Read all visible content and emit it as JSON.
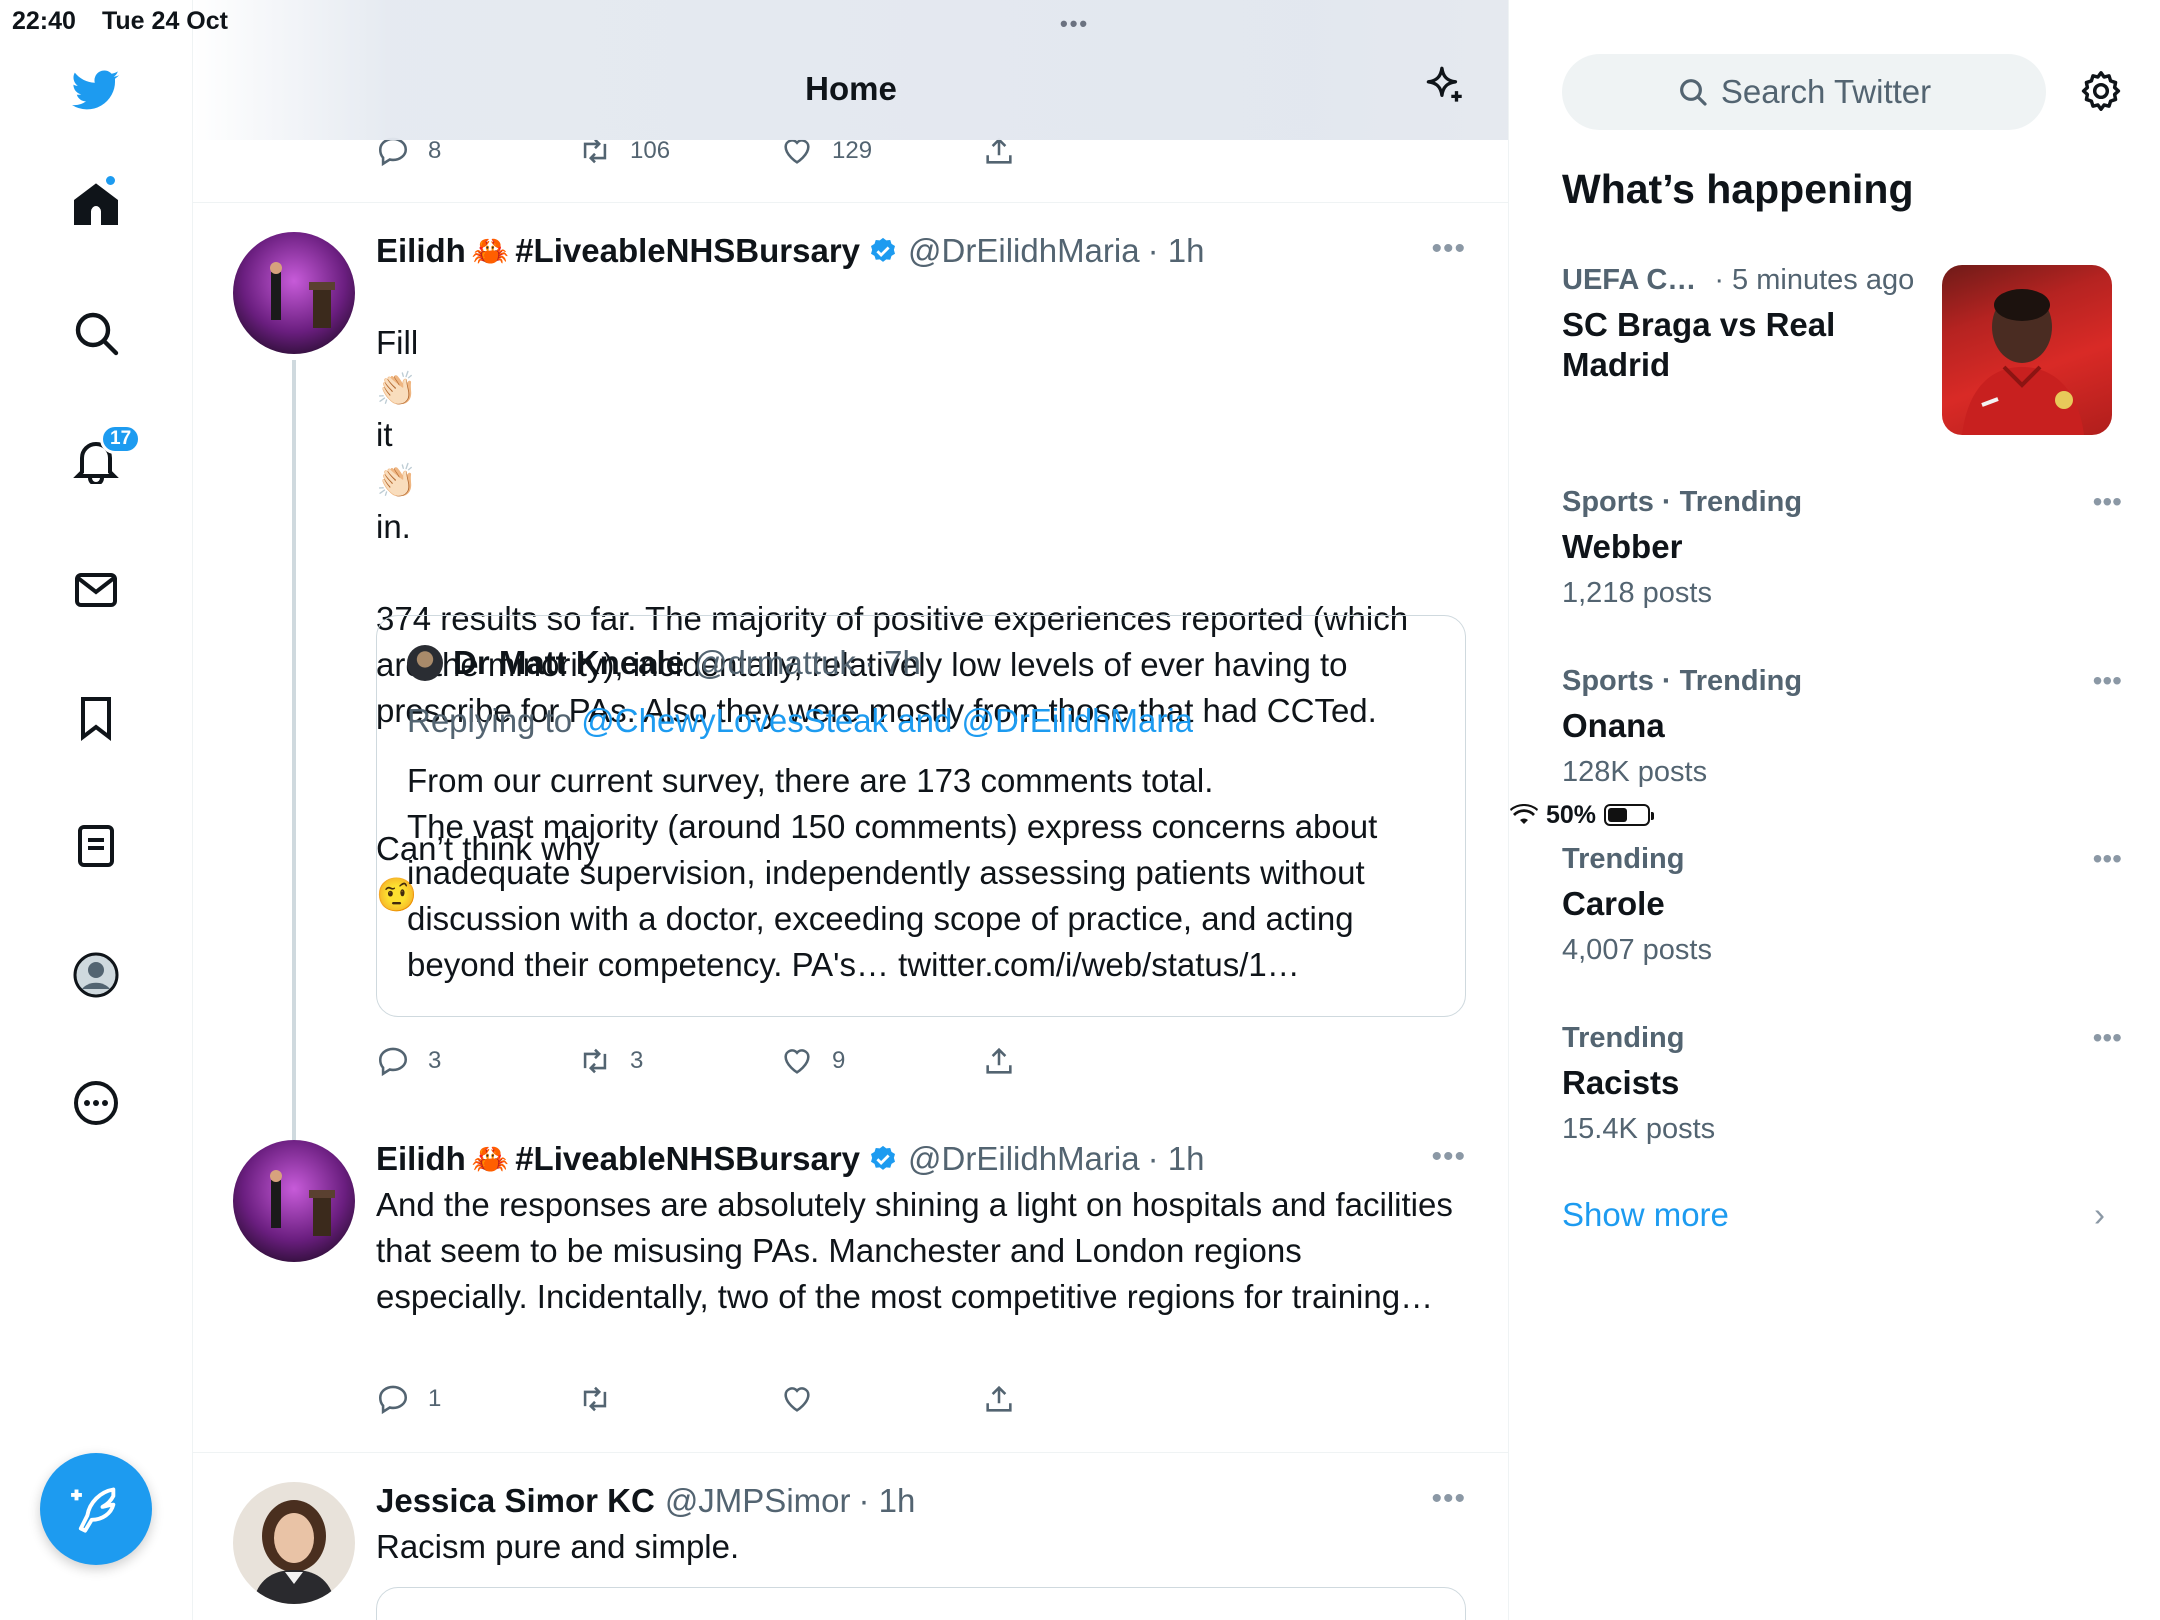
{
  "status_bar": {
    "time": "22:40",
    "date": "Tue 24 Oct",
    "grip": "•••",
    "battery": "50%",
    "battery_level": 0.5
  },
  "nav": {
    "notifications_badge": "17",
    "icons": [
      "twitter-bird-icon",
      "home-icon",
      "search-icon",
      "bell-icon",
      "mail-icon",
      "bookmark-icon",
      "list-icon",
      "profile-icon",
      "more-icon"
    ]
  },
  "header": {
    "title": "Home"
  },
  "previous_tweet": {
    "replies": "8",
    "retweets": "106",
    "likes": "129"
  },
  "tweets": [
    {
      "name": "Eilidh",
      "name_tag": "#LiveableNHSBursary",
      "handle": "@DrEilidhMaria",
      "time": "· 1h",
      "text_line1_a": "Fill",
      "text_line1_b": "it",
      "text_line1_c": "in.",
      "text": "374 results so far. The majority of positive experiences reported (which are  the minority), incidentally, relatively low levels of ever having to prescribe for PAs. Also they were mostly from those that had CCTed.",
      "text2": "Can’t think why",
      "quote": {
        "name": "Dr Matt Kneale",
        "handle": "@drmattuk",
        "time": "· 7h",
        "replying_prefix": "Replying to",
        "replying_to": "@ChewyLovesSteak and @DrEilidhMaria",
        "text": "From our current survey, there are 173 comments total.\nThe vast majority (around 150 comments) express concerns about inadequate supervision, independently assessing patients without discussion with a doctor, exceeding scope of practice, and acting beyond their competency. PA's… twitter.com/i/web/status/1…"
      },
      "replies": "3",
      "retweets": "3",
      "likes": "9"
    },
    {
      "name": "Eilidh",
      "name_tag": "#LiveableNHSBursary",
      "handle": "@DrEilidhMaria",
      "time": "· 1h",
      "text": "And the responses are absolutely shining a light on hospitals and facilities that seem to be misusing PAs. Manchester and London regions especially. Incidentally, two of the most competitive regions for training…",
      "replies": "1",
      "retweets": "",
      "likes": ""
    },
    {
      "name": "Jessica Simor KC",
      "handle": "@JMPSimor",
      "time": "· 1h",
      "text": "Racism pure and simple."
    }
  ],
  "sidebar": {
    "search_placeholder": "Search Twitter",
    "title": "What’s happening",
    "trends": [
      {
        "meta": "UEFA C…",
        "meta_time": "· 5 minutes ago",
        "topic": "SC Braga vs Real Madrid"
      },
      {
        "meta": "Sports · Trending",
        "topic": "Webber",
        "posts": "1,218 posts"
      },
      {
        "meta": "Sports · Trending",
        "topic": "Onana",
        "posts": "128K posts"
      },
      {
        "meta": "Trending",
        "topic": "Carole",
        "posts": "4,007 posts"
      },
      {
        "meta": "Trending",
        "topic": "Racists",
        "posts": "15.4K posts"
      }
    ],
    "show_more": "Show more"
  },
  "colors": {
    "accent": "#1d9bf0",
    "text": "#0f1419",
    "muted": "#536471",
    "border": "#eff3f4"
  }
}
